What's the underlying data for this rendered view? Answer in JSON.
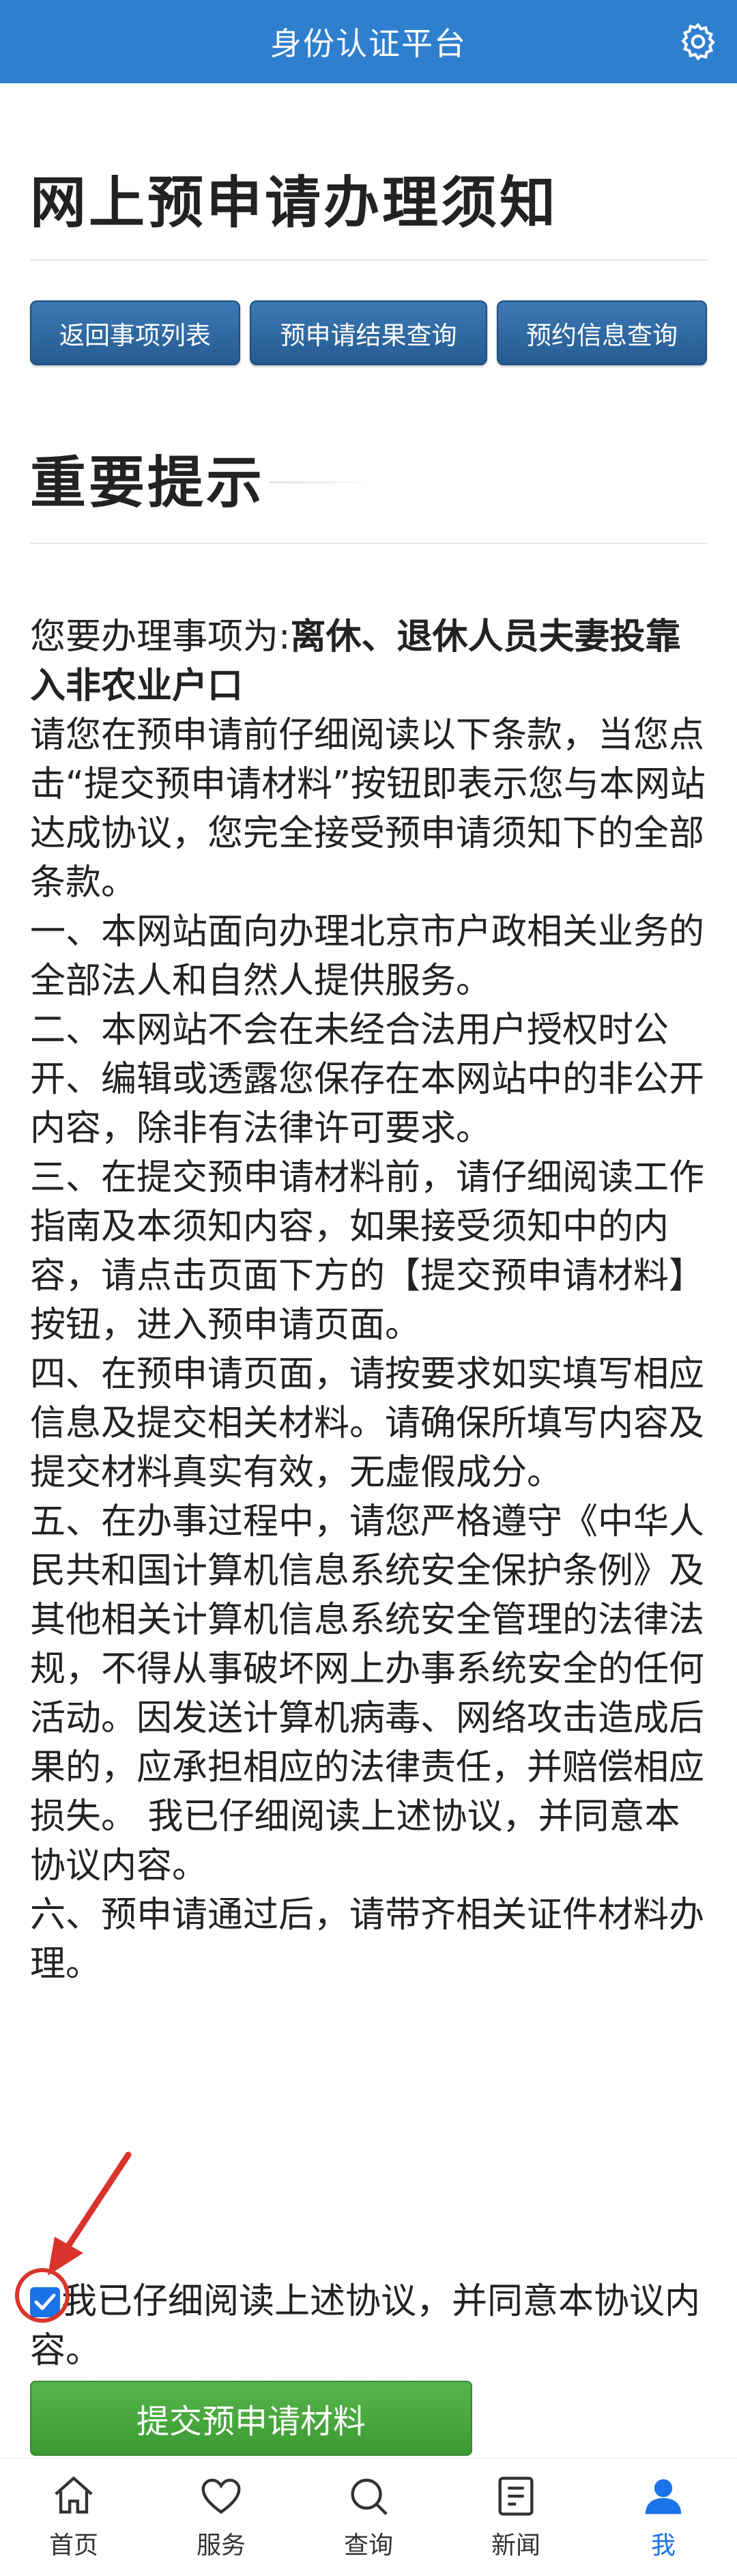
{
  "header": {
    "title": "身份认证平台",
    "settings_icon": "gear-icon",
    "bg_color": "#2f7fcf"
  },
  "page_title": "网上预申请办理须知",
  "buttons": {
    "back": "返回事项列表",
    "result_query": "预申请结果查询",
    "appointment_query": "预约信息查询"
  },
  "section_title": "重要提示",
  "notice": {
    "matter_prefix": "您要办理事项为:",
    "matter_name": "离休、退休人员夫妻投靠入非农业户口",
    "paragraphs": [
      "请您在预申请前仔细阅读以下条款，当您点击“提交预申请材料”按钮即表示您与本网站达成协议，您完全接受预申请须知下的全部条款。",
      "一、本网站面向办理北京市户政相关业务的全部法人和自然人提供服务。",
      "二、本网站不会在未经合法用户授权时公开、编辑或透露您保存在本网站中的非公开内容，除非有法律许可要求。",
      "三、在提交预申请材料前，请仔细阅读工作指南及本须知内容，如果接受须知中的内容，请点击页面下方的【提交预申请材料】按钮，进入预申请页面。",
      "四、在预申请页面，请按要求如实填写相应信息及提交相关材料。请确保所填写内容及提交材料真实有效，无虚假成分。",
      "五、在办事过程中，请您严格遵守《中华人民共和国计算机信息系统安全保护条例》及其他相关计算机信息系统安全管理的法律法规，不得从事破坏网上办事系统安全的任何活动。因发送计算机病毒、网络攻击造成后果的，应承担相应的法律责任，并赔偿相应损失。 我已仔细阅读上述协议，并同意本协议内容。",
      "六、预申请通过后，请带齐相关证件材料办理。"
    ]
  },
  "agreement": {
    "checked": true,
    "label": "我已仔细阅读上述协议，并同意本协议内容。"
  },
  "submit_label": "提交预申请材料",
  "tabbar": [
    {
      "label": "首页",
      "icon": "home-icon",
      "active": false
    },
    {
      "label": "服务",
      "icon": "heart-icon",
      "active": false
    },
    {
      "label": "查询",
      "icon": "search-icon",
      "active": false
    },
    {
      "label": "新闻",
      "icon": "news-icon",
      "active": false
    },
    {
      "label": "我",
      "icon": "person-icon",
      "active": true
    }
  ],
  "colors": {
    "accent": "#1a73e8",
    "nav_button": "#2f6aa3",
    "submit": "#4aa83f",
    "annotation": "#d9342b"
  }
}
